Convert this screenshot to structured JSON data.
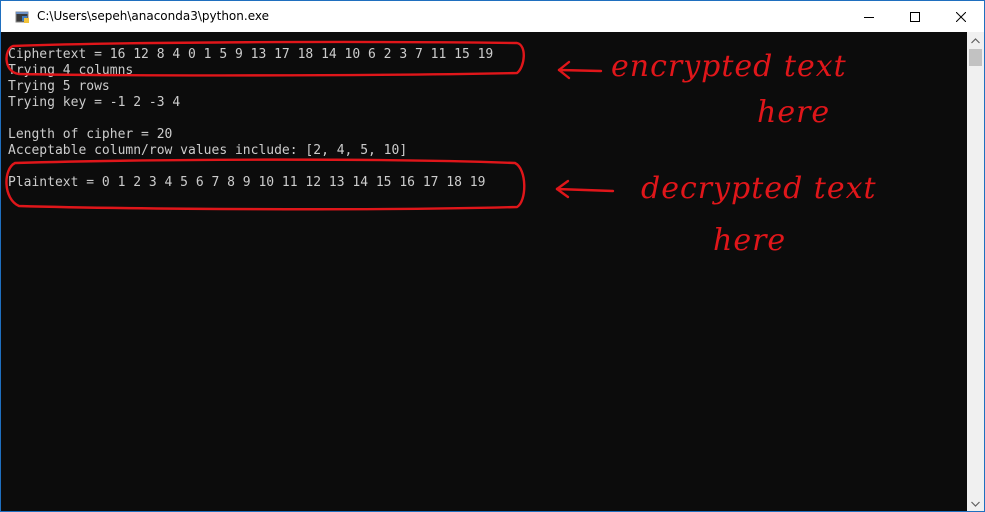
{
  "window": {
    "title": "C:\\Users\\sepeh\\anaconda3\\python.exe",
    "icon": "python-console-icon"
  },
  "caption_buttons": {
    "minimize_icon": "minimize-icon",
    "maximize_icon": "maximize-icon",
    "close_icon": "close-icon"
  },
  "console": {
    "lines": [
      "Ciphertext = 16 12 8 4 0 1 5 9 13 17 18 14 10 6 2 3 7 11 15 19",
      "Trying 4 columns",
      "Trying 5 rows",
      "Trying key = -1 2 -3 4",
      "",
      "Length of cipher = 20",
      "Acceptable column/row values include: [2, 4, 5, 10]",
      "",
      "Plaintext = 0 1 2 3 4 5 6 7 8 9 10 11 12 13 14 15 16 17 18 19"
    ],
    "text_color": "#cccccc",
    "background_color": "#0c0c0c"
  },
  "annotations": {
    "color": "#e0161a",
    "encrypted_label_line1": "encrypted text",
    "encrypted_label_line2": "here",
    "decrypted_label_line1": "decrypted text",
    "decrypted_label_line2": "here"
  }
}
